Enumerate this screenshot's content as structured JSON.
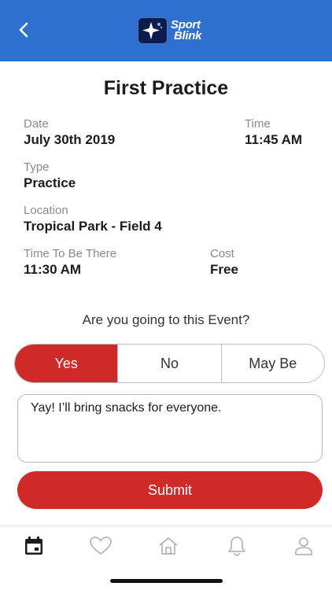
{
  "header": {
    "back_icon": "chevron-left-icon",
    "logo_line1": "Sport",
    "logo_line2": "Blink",
    "color": "#2f6fd0"
  },
  "event": {
    "title": "First Practice",
    "date_label": "Date",
    "date_value": "July 30th 2019",
    "time_label": "Time",
    "time_value": "11:45 AM",
    "type_label": "Type",
    "type_value": "Practice",
    "location_label": "Location",
    "location_value": "Tropical Park - Field 4",
    "arrival_label": "Time To Be There",
    "arrival_value": "11:30 AM",
    "cost_label": "Cost",
    "cost_value": "Free"
  },
  "rsvp": {
    "question": "Are you going to this Event?",
    "options": [
      "Yes",
      "No",
      "May Be"
    ],
    "selected": "Yes",
    "accent": "#cf2a27"
  },
  "comment": {
    "value": "Yay! I’ll bring snacks for everyone."
  },
  "submit_label": "Submit",
  "tabbar": {
    "items": [
      "calendar-icon",
      "heart-icon",
      "home-icon",
      "bell-icon",
      "user-icon"
    ],
    "active": "calendar-icon"
  }
}
